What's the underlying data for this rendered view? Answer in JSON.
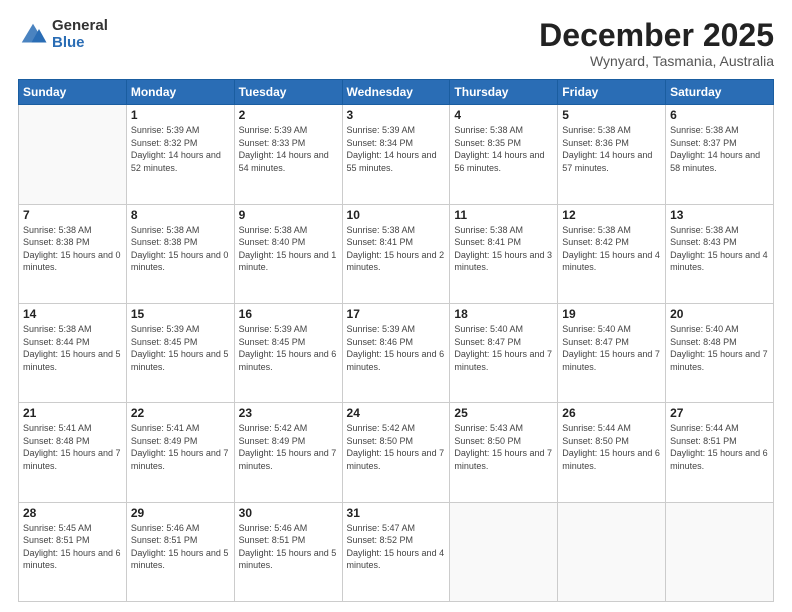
{
  "logo": {
    "general": "General",
    "blue": "Blue"
  },
  "header": {
    "month": "December 2025",
    "location": "Wynyard, Tasmania, Australia"
  },
  "weekdays": [
    "Sunday",
    "Monday",
    "Tuesday",
    "Wednesday",
    "Thursday",
    "Friday",
    "Saturday"
  ],
  "weeks": [
    [
      {
        "day": "",
        "sunrise": "",
        "sunset": "",
        "daylight": ""
      },
      {
        "day": "1",
        "sunrise": "Sunrise: 5:39 AM",
        "sunset": "Sunset: 8:32 PM",
        "daylight": "Daylight: 14 hours and 52 minutes."
      },
      {
        "day": "2",
        "sunrise": "Sunrise: 5:39 AM",
        "sunset": "Sunset: 8:33 PM",
        "daylight": "Daylight: 14 hours and 54 minutes."
      },
      {
        "day": "3",
        "sunrise": "Sunrise: 5:39 AM",
        "sunset": "Sunset: 8:34 PM",
        "daylight": "Daylight: 14 hours and 55 minutes."
      },
      {
        "day": "4",
        "sunrise": "Sunrise: 5:38 AM",
        "sunset": "Sunset: 8:35 PM",
        "daylight": "Daylight: 14 hours and 56 minutes."
      },
      {
        "day": "5",
        "sunrise": "Sunrise: 5:38 AM",
        "sunset": "Sunset: 8:36 PM",
        "daylight": "Daylight: 14 hours and 57 minutes."
      },
      {
        "day": "6",
        "sunrise": "Sunrise: 5:38 AM",
        "sunset": "Sunset: 8:37 PM",
        "daylight": "Daylight: 14 hours and 58 minutes."
      }
    ],
    [
      {
        "day": "7",
        "sunrise": "Sunrise: 5:38 AM",
        "sunset": "Sunset: 8:38 PM",
        "daylight": "Daylight: 15 hours and 0 minutes."
      },
      {
        "day": "8",
        "sunrise": "Sunrise: 5:38 AM",
        "sunset": "Sunset: 8:38 PM",
        "daylight": "Daylight: 15 hours and 0 minutes."
      },
      {
        "day": "9",
        "sunrise": "Sunrise: 5:38 AM",
        "sunset": "Sunset: 8:40 PM",
        "daylight": "Daylight: 15 hours and 1 minute."
      },
      {
        "day": "10",
        "sunrise": "Sunrise: 5:38 AM",
        "sunset": "Sunset: 8:41 PM",
        "daylight": "Daylight: 15 hours and 2 minutes."
      },
      {
        "day": "11",
        "sunrise": "Sunrise: 5:38 AM",
        "sunset": "Sunset: 8:41 PM",
        "daylight": "Daylight: 15 hours and 3 minutes."
      },
      {
        "day": "12",
        "sunrise": "Sunrise: 5:38 AM",
        "sunset": "Sunset: 8:42 PM",
        "daylight": "Daylight: 15 hours and 4 minutes."
      },
      {
        "day": "13",
        "sunrise": "Sunrise: 5:38 AM",
        "sunset": "Sunset: 8:43 PM",
        "daylight": "Daylight: 15 hours and 4 minutes."
      }
    ],
    [
      {
        "day": "14",
        "sunrise": "Sunrise: 5:38 AM",
        "sunset": "Sunset: 8:44 PM",
        "daylight": "Daylight: 15 hours and 5 minutes."
      },
      {
        "day": "15",
        "sunrise": "Sunrise: 5:39 AM",
        "sunset": "Sunset: 8:45 PM",
        "daylight": "Daylight: 15 hours and 5 minutes."
      },
      {
        "day": "16",
        "sunrise": "Sunrise: 5:39 AM",
        "sunset": "Sunset: 8:45 PM",
        "daylight": "Daylight: 15 hours and 6 minutes."
      },
      {
        "day": "17",
        "sunrise": "Sunrise: 5:39 AM",
        "sunset": "Sunset: 8:46 PM",
        "daylight": "Daylight: 15 hours and 6 minutes."
      },
      {
        "day": "18",
        "sunrise": "Sunrise: 5:40 AM",
        "sunset": "Sunset: 8:47 PM",
        "daylight": "Daylight: 15 hours and 7 minutes."
      },
      {
        "day": "19",
        "sunrise": "Sunrise: 5:40 AM",
        "sunset": "Sunset: 8:47 PM",
        "daylight": "Daylight: 15 hours and 7 minutes."
      },
      {
        "day": "20",
        "sunrise": "Sunrise: 5:40 AM",
        "sunset": "Sunset: 8:48 PM",
        "daylight": "Daylight: 15 hours and 7 minutes."
      }
    ],
    [
      {
        "day": "21",
        "sunrise": "Sunrise: 5:41 AM",
        "sunset": "Sunset: 8:48 PM",
        "daylight": "Daylight: 15 hours and 7 minutes."
      },
      {
        "day": "22",
        "sunrise": "Sunrise: 5:41 AM",
        "sunset": "Sunset: 8:49 PM",
        "daylight": "Daylight: 15 hours and 7 minutes."
      },
      {
        "day": "23",
        "sunrise": "Sunrise: 5:42 AM",
        "sunset": "Sunset: 8:49 PM",
        "daylight": "Daylight: 15 hours and 7 minutes."
      },
      {
        "day": "24",
        "sunrise": "Sunrise: 5:42 AM",
        "sunset": "Sunset: 8:50 PM",
        "daylight": "Daylight: 15 hours and 7 minutes."
      },
      {
        "day": "25",
        "sunrise": "Sunrise: 5:43 AM",
        "sunset": "Sunset: 8:50 PM",
        "daylight": "Daylight: 15 hours and 7 minutes."
      },
      {
        "day": "26",
        "sunrise": "Sunrise: 5:44 AM",
        "sunset": "Sunset: 8:50 PM",
        "daylight": "Daylight: 15 hours and 6 minutes."
      },
      {
        "day": "27",
        "sunrise": "Sunrise: 5:44 AM",
        "sunset": "Sunset: 8:51 PM",
        "daylight": "Daylight: 15 hours and 6 minutes."
      }
    ],
    [
      {
        "day": "28",
        "sunrise": "Sunrise: 5:45 AM",
        "sunset": "Sunset: 8:51 PM",
        "daylight": "Daylight: 15 hours and 6 minutes."
      },
      {
        "day": "29",
        "sunrise": "Sunrise: 5:46 AM",
        "sunset": "Sunset: 8:51 PM",
        "daylight": "Daylight: 15 hours and 5 minutes."
      },
      {
        "day": "30",
        "sunrise": "Sunrise: 5:46 AM",
        "sunset": "Sunset: 8:51 PM",
        "daylight": "Daylight: 15 hours and 5 minutes."
      },
      {
        "day": "31",
        "sunrise": "Sunrise: 5:47 AM",
        "sunset": "Sunset: 8:52 PM",
        "daylight": "Daylight: 15 hours and 4 minutes."
      },
      {
        "day": "",
        "sunrise": "",
        "sunset": "",
        "daylight": ""
      },
      {
        "day": "",
        "sunrise": "",
        "sunset": "",
        "daylight": ""
      },
      {
        "day": "",
        "sunrise": "",
        "sunset": "",
        "daylight": ""
      }
    ]
  ]
}
